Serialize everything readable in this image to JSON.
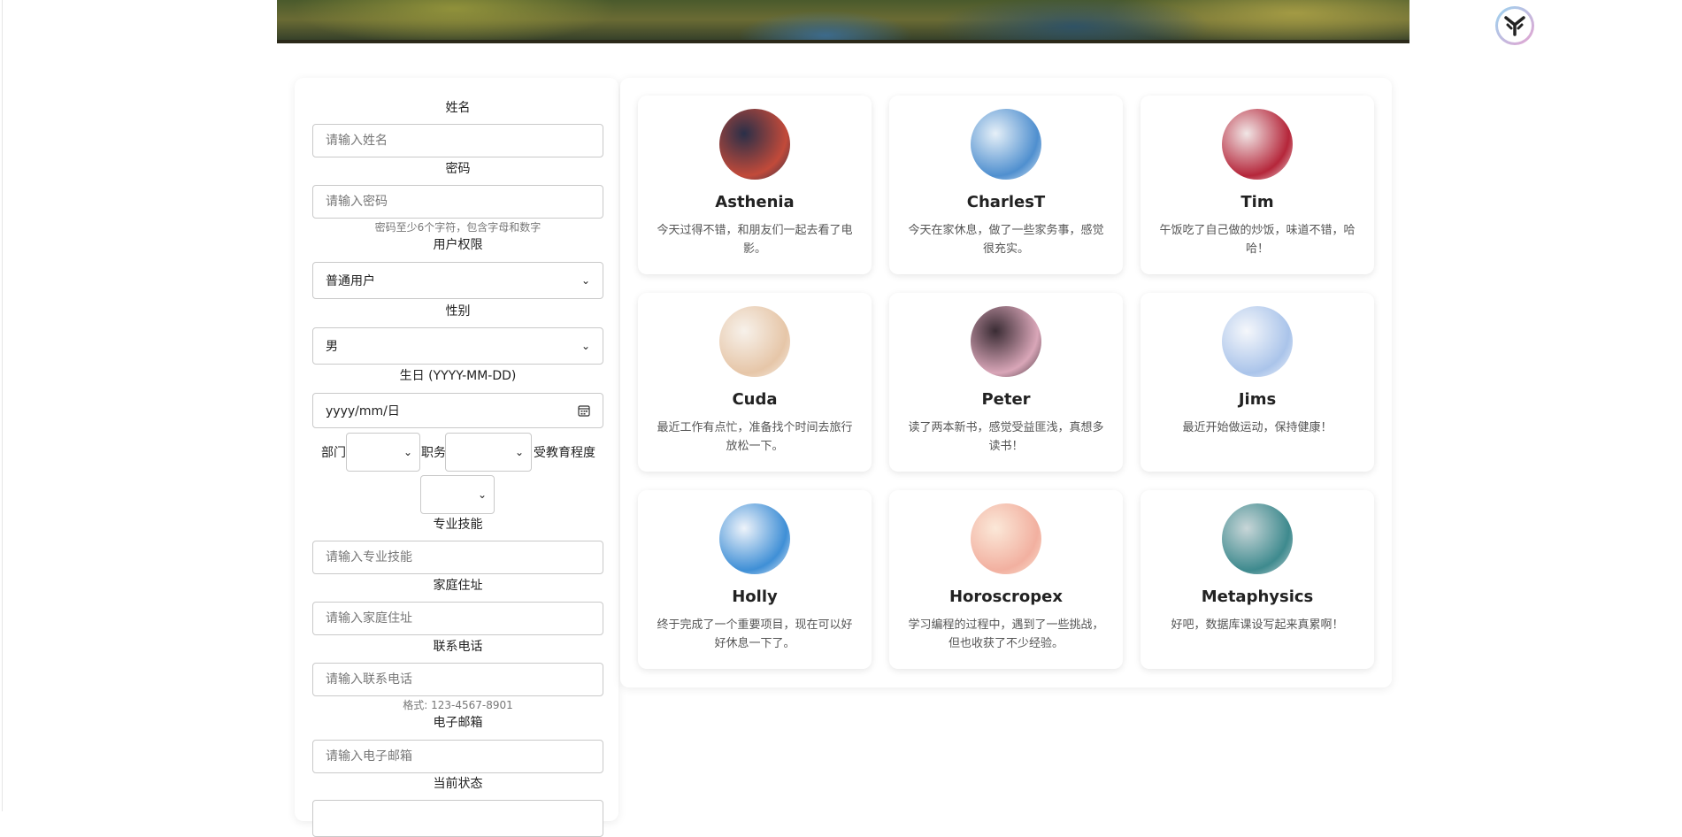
{
  "form": {
    "name_label": "姓名",
    "name_placeholder": "请输入姓名",
    "password_label": "密码",
    "password_placeholder": "请输入密码",
    "password_hint": "密码至少6个字符，包含字母和数字",
    "role_label": "用户权限",
    "role_value": "普通用户",
    "gender_label": "性别",
    "gender_value": "男",
    "birthday_label": "生日 (YYYY-MM-DD)",
    "birthday_value": "yyyy/mm/日",
    "department_label": "部门",
    "position_label": "职务",
    "education_label": "受教育程度",
    "skills_label": "专业技能",
    "skills_placeholder": "请输入专业技能",
    "address_label": "家庭住址",
    "address_placeholder": "请输入家庭住址",
    "phone_label": "联系电话",
    "phone_placeholder": "请输入联系电话",
    "phone_hint": "格式: 123-4567-8901",
    "email_label": "电子邮箱",
    "email_placeholder": "请输入电子邮箱",
    "status_label": "当前状态"
  },
  "cards": [
    {
      "name": "Asthenia",
      "text": "今天过得不错，和朋友们一起去看了电影。",
      "colors": [
        "#c24a3a",
        "#2a2f48"
      ]
    },
    {
      "name": "CharlesT",
      "text": "今天在家休息，做了一些家务事，感觉很充实。",
      "colors": [
        "#4f8fcf",
        "#e6f0f8"
      ]
    },
    {
      "name": "Tim",
      "text": "午饭吃了自己做的炒饭，味道不错，哈哈！",
      "colors": [
        "#b5263a",
        "#f1e6e6"
      ]
    },
    {
      "name": "Cuda",
      "text": "最近工作有点忙，准备找个时间去旅行放松一下。",
      "colors": [
        "#e6c6a8",
        "#f7f1ea"
      ]
    },
    {
      "name": "Peter",
      "text": "读了两本新书，感觉受益匪浅，真想多读书！",
      "colors": [
        "#d9a6b8",
        "#3a2c34"
      ]
    },
    {
      "name": "Jims",
      "text": "最近开始做运动，保持健康！",
      "colors": [
        "#aac4ea",
        "#f5f7fb"
      ]
    },
    {
      "name": "Holly",
      "text": "终于完成了一个重要项目，现在可以好好休息一下了。",
      "colors": [
        "#3f8fd6",
        "#eef3fa"
      ]
    },
    {
      "name": "Horoscropex",
      "text": "学习编程的过程中，遇到了一些挑战，但也收获了不少经验。",
      "colors": [
        "#f2b0a0",
        "#fbe8d8"
      ]
    },
    {
      "name": "Metaphysics",
      "text": "好吧，数据库课设写起来真累啊！",
      "colors": [
        "#3e8a8e",
        "#c8d6d8"
      ]
    }
  ]
}
